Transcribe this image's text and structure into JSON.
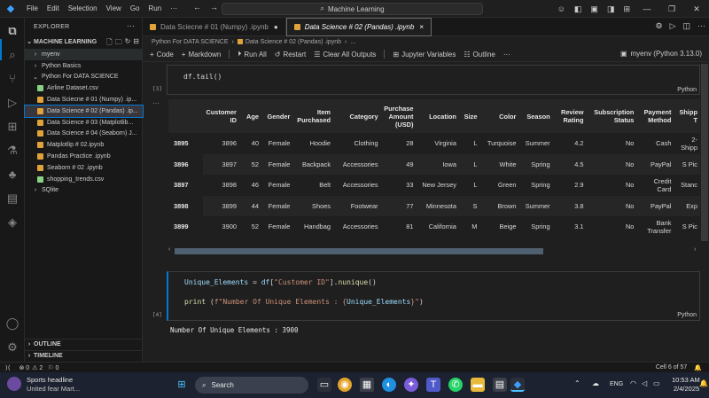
{
  "menu": {
    "items": [
      "File",
      "Edit",
      "Selection",
      "View",
      "Go",
      "Run"
    ],
    "more": "···"
  },
  "command_center": {
    "text": "Machine Learning"
  },
  "sidebar": {
    "title": "EXPLORER",
    "section": "MACHINE LEARNING",
    "tree": [
      {
        "label": "myenv",
        "type": "folder",
        "chev": "›",
        "indent": 1,
        "state": "selected-folder"
      },
      {
        "label": "Python Basics",
        "type": "folder",
        "chev": "›",
        "indent": 1
      },
      {
        "label": "Python For DATA SCIENCE",
        "type": "folder",
        "chev": "⌄",
        "indent": 1
      },
      {
        "label": "Airline Dataset.csv",
        "type": "csv",
        "indent": 2
      },
      {
        "label": "Data Sciecne # 01 (Numpy) .ip...",
        "type": "nb",
        "indent": 2
      },
      {
        "label": "Data Science # 02 (Pandas) .ip...",
        "type": "nb",
        "indent": 2,
        "state": "selected"
      },
      {
        "label": "Data Science # 03 (Matplotlib...",
        "type": "nb",
        "indent": 2
      },
      {
        "label": "Data Science # 04 (Seaborn) J...",
        "type": "nb",
        "indent": 2
      },
      {
        "label": "Matplotlip # 02.ipynb",
        "type": "nb",
        "indent": 2
      },
      {
        "label": "Pandas Practice .ipynb",
        "type": "nb",
        "indent": 2
      },
      {
        "label": "Seaborn # 02 .ipynb",
        "type": "nb",
        "indent": 2
      },
      {
        "label": "shopping_trends.csv",
        "type": "csv",
        "indent": 2
      },
      {
        "label": "SQlite",
        "type": "folder",
        "chev": "›",
        "indent": 1
      }
    ],
    "outline": "OUTLINE",
    "timeline": "TIMELINE"
  },
  "tabs": [
    {
      "label": "Data Sciecne # 01 (Numpy) .ipynb",
      "dirty": "●",
      "active": false
    },
    {
      "label": "Data Science # 02 (Pandas) .ipynb",
      "close": "×",
      "active": true
    }
  ],
  "breadcrumb": [
    "Python For DATA SCIENCE",
    "Data Science # 02 (Pandas) .ipynb",
    "..."
  ],
  "toolbar": {
    "code": "Code",
    "markdown": "Markdown",
    "run_all": "Run All",
    "restart": "Restart",
    "clear": "Clear All Outputs",
    "variables": "Jupyter Variables",
    "outline": "Outline",
    "more": "···",
    "kernel": "myenv (Python 3.13.0)"
  },
  "cells": {
    "cell3": {
      "number": "[3]",
      "code": "df.tail()",
      "lang": "Python"
    },
    "cell4": {
      "number": "[4]",
      "lang": "Python",
      "line1": {
        "var": "Unique_Elements",
        "op": " = ",
        "df": "df",
        "bracket_open": "[",
        "str": "\"Customer ID\"",
        "bracket_close": "].",
        "fn": "nunique",
        "paren": "()"
      },
      "line2": {
        "fn": "print",
        "open": " (",
        "str": "f\"Number Of Unique Elements : {",
        "var": "Unique_Elements",
        "str2": "}\"",
        "close": ")"
      },
      "output": "Number Of Unique Elements : 3900"
    }
  },
  "table": {
    "columns": [
      "",
      "Customer ID",
      "Age",
      "Gender",
      "Item Purchased",
      "Category",
      "Purchase Amount (USD)",
      "Location",
      "Size",
      "Color",
      "Season",
      "Review Rating",
      "Subscription Status",
      "Payment Method",
      "Shipp T"
    ],
    "rows": [
      [
        "3895",
        "3896",
        "40",
        "Female",
        "Hoodie",
        "Clothing",
        "28",
        "Virginia",
        "L",
        "Turquoise",
        "Summer",
        "4.2",
        "No",
        "Cash",
        "2-Shipp"
      ],
      [
        "3896",
        "3897",
        "52",
        "Female",
        "Backpack",
        "Accessories",
        "49",
        "Iowa",
        "L",
        "White",
        "Spring",
        "4.5",
        "No",
        "PayPal",
        "S Pic"
      ],
      [
        "3897",
        "3898",
        "46",
        "Female",
        "Belt",
        "Accessories",
        "33",
        "New Jersey",
        "L",
        "Green",
        "Spring",
        "2.9",
        "No",
        "Credit Card",
        "Stanc"
      ],
      [
        "3898",
        "3899",
        "44",
        "Female",
        "Shoes",
        "Footwear",
        "77",
        "Minnesota",
        "S",
        "Brown",
        "Summer",
        "3.8",
        "No",
        "PayPal",
        "Exp"
      ],
      [
        "3899",
        "3900",
        "52",
        "Female",
        "Handbag",
        "Accessories",
        "81",
        "California",
        "M",
        "Beige",
        "Spring",
        "3.1",
        "No",
        "Bank Transfer",
        "S Pic"
      ]
    ]
  },
  "statusbar": {
    "errors": "⊗ 0",
    "warnings": "⚠ 2",
    "ports": "⚐ 0",
    "cell": "Cell 6 of 57"
  },
  "taskbar": {
    "news_title": "Sports headline",
    "news_sub": "United fear Mart...",
    "search": "Search",
    "lang": "ENG",
    "time": "10:53 AM",
    "date": "2/4/2025"
  },
  "colors": {
    "accent": "#0078d4",
    "notebook_icon": "#e0a33a",
    "csv_icon": "#89d185"
  }
}
